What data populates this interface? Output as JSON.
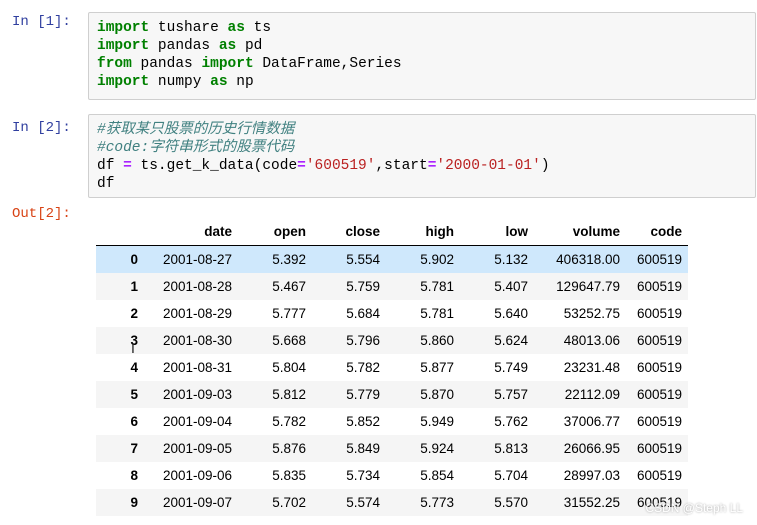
{
  "cell1": {
    "prompt": "In [1]:",
    "lines": [
      [
        [
          "kw",
          "import"
        ],
        [
          "t",
          " tushare "
        ],
        [
          "kw",
          "as"
        ],
        [
          "t",
          " ts"
        ]
      ],
      [
        [
          "kw",
          "import"
        ],
        [
          "t",
          " pandas "
        ],
        [
          "kw",
          "as"
        ],
        [
          "t",
          " pd"
        ]
      ],
      [
        [
          "kw",
          "from"
        ],
        [
          "t",
          " pandas "
        ],
        [
          "kw",
          "import"
        ],
        [
          "t",
          " DataFrame,Series"
        ]
      ],
      [
        [
          "kw",
          "import"
        ],
        [
          "t",
          " numpy "
        ],
        [
          "kw",
          "as"
        ],
        [
          "t",
          " np"
        ]
      ]
    ]
  },
  "cell2": {
    "prompt": "In [2]:",
    "lines": [
      [
        [
          "cm",
          "#获取某只股票的历史行情数据"
        ]
      ],
      [
        [
          "cm",
          "#code:字符串形式的股票代码"
        ]
      ],
      [
        [
          "t",
          "df "
        ],
        [
          "op",
          "="
        ],
        [
          "t",
          " ts.get_k_data(code"
        ],
        [
          "op",
          "="
        ],
        [
          "str",
          "'600519'"
        ],
        [
          "t",
          ",start"
        ],
        [
          "op",
          "="
        ],
        [
          "str",
          "'2000-01-01'"
        ],
        [
          "t",
          ")"
        ]
      ],
      [
        [
          "t",
          "df"
        ]
      ]
    ]
  },
  "out2": {
    "prompt": "Out[2]:"
  },
  "table": {
    "columns": [
      "",
      "date",
      "open",
      "close",
      "high",
      "low",
      "volume",
      "code"
    ],
    "rows": [
      [
        "0",
        "2001-08-27",
        "5.392",
        "5.554",
        "5.902",
        "5.132",
        "406318.00",
        "600519"
      ],
      [
        "1",
        "2001-08-28",
        "5.467",
        "5.759",
        "5.781",
        "5.407",
        "129647.79",
        "600519"
      ],
      [
        "2",
        "2001-08-29",
        "5.777",
        "5.684",
        "5.781",
        "5.640",
        "53252.75",
        "600519"
      ],
      [
        "3",
        "2001-08-30",
        "5.668",
        "5.796",
        "5.860",
        "5.624",
        "48013.06",
        "600519"
      ],
      [
        "4",
        "2001-08-31",
        "5.804",
        "5.782",
        "5.877",
        "5.749",
        "23231.48",
        "600519"
      ],
      [
        "5",
        "2001-09-03",
        "5.812",
        "5.779",
        "5.870",
        "5.757",
        "22112.09",
        "600519"
      ],
      [
        "6",
        "2001-09-04",
        "5.782",
        "5.852",
        "5.949",
        "5.762",
        "37006.77",
        "600519"
      ],
      [
        "7",
        "2001-09-05",
        "5.876",
        "5.849",
        "5.924",
        "5.813",
        "26066.95",
        "600519"
      ],
      [
        "8",
        "2001-09-06",
        "5.835",
        "5.734",
        "5.854",
        "5.704",
        "28997.03",
        "600519"
      ],
      [
        "9",
        "2001-09-07",
        "5.702",
        "5.574",
        "5.773",
        "5.570",
        "31552.25",
        "600519"
      ]
    ],
    "selected_row": 0
  },
  "watermark": "CSDN @Steph LL"
}
